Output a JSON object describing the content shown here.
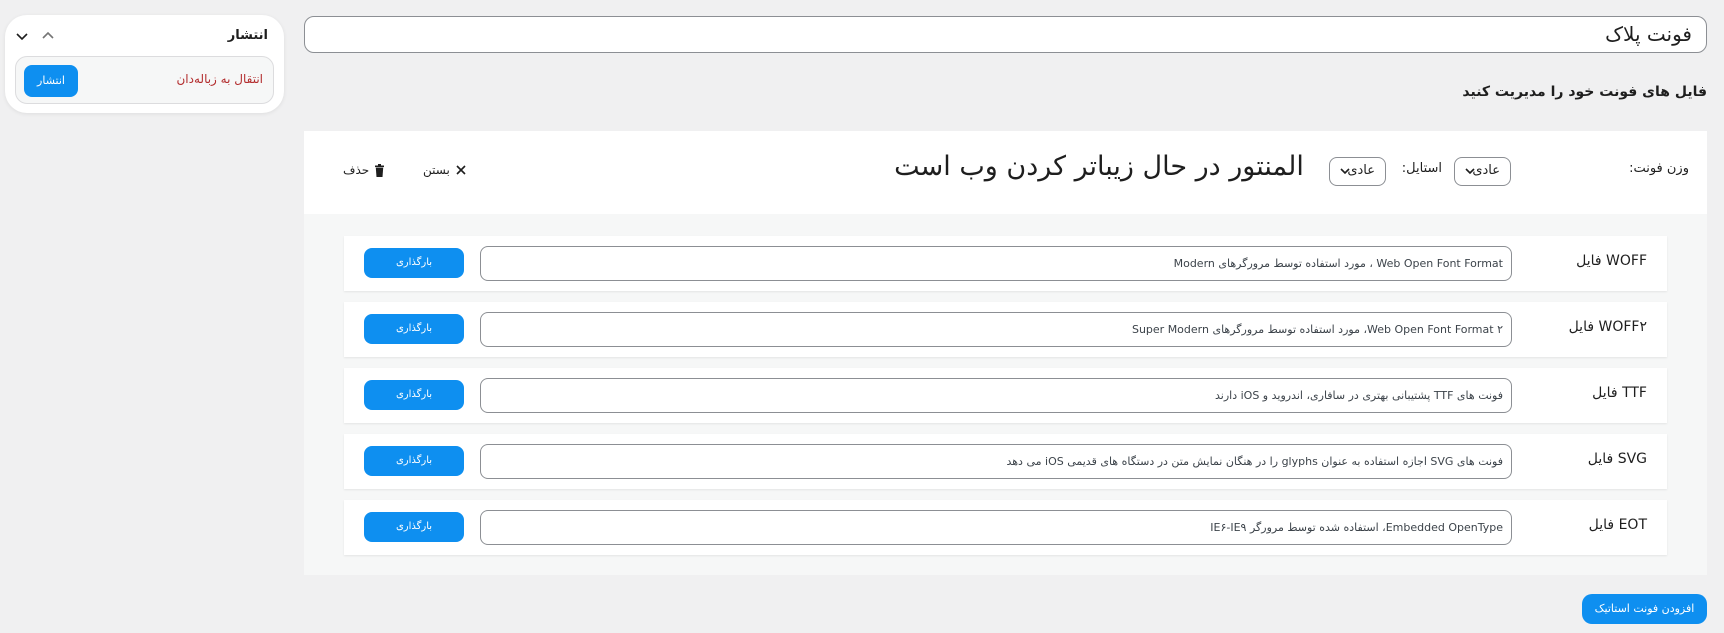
{
  "post_title": "فونت پلاک",
  "manage_label": "فایل های فونت خود را مدیریت کنید",
  "font_variation": {
    "weight_label": "وزن فونت:",
    "weight_value": "عادی",
    "style_label": "استایل:",
    "style_value": "عادی",
    "preview_text": "المنتور در حال زیباتر کردن وب است",
    "close_label": "بستن",
    "delete_label": "حذف",
    "files": [
      {
        "label": "WOFF فایل",
        "description": "Web Open Font Format ، مورد استفاده توسط مرورگرهای Modern",
        "button": "بارگذاری"
      },
      {
        "label": "WOFF۲ فایل",
        "description": "Web Open Font Format ۲، مورد استفاده توسط مرورگرهای Super Modern",
        "button": "بارگذاری"
      },
      {
        "label": "TTF فایل",
        "description": "فونت های TTF پشتیبانی بهتری در سافاری، اندروید و iOS دارند",
        "button": "بارگذاری"
      },
      {
        "label": "SVG فایل",
        "description": "فونت های SVG اجازه استفاده به عنوان glyphs را در هنگان نمایش متن در دستگاه های قدیمی iOS می دهد",
        "button": "بارگذاری"
      },
      {
        "label": "EOT فایل",
        "description": "Embedded OpenType، استفاده شده توسط مرورگر IE۶-IE۹",
        "button": "بارگذاری"
      }
    ]
  },
  "add_static_button": "افزودن فونت استاتیک",
  "publish_panel": {
    "title": "انتشار",
    "trash_link": "انتقال به زباله‌دان",
    "publish_button": "انتشار"
  },
  "colors": {
    "accent": "#0e8ff0",
    "danger": "#b32d2e",
    "background": "#f0f0f1"
  }
}
